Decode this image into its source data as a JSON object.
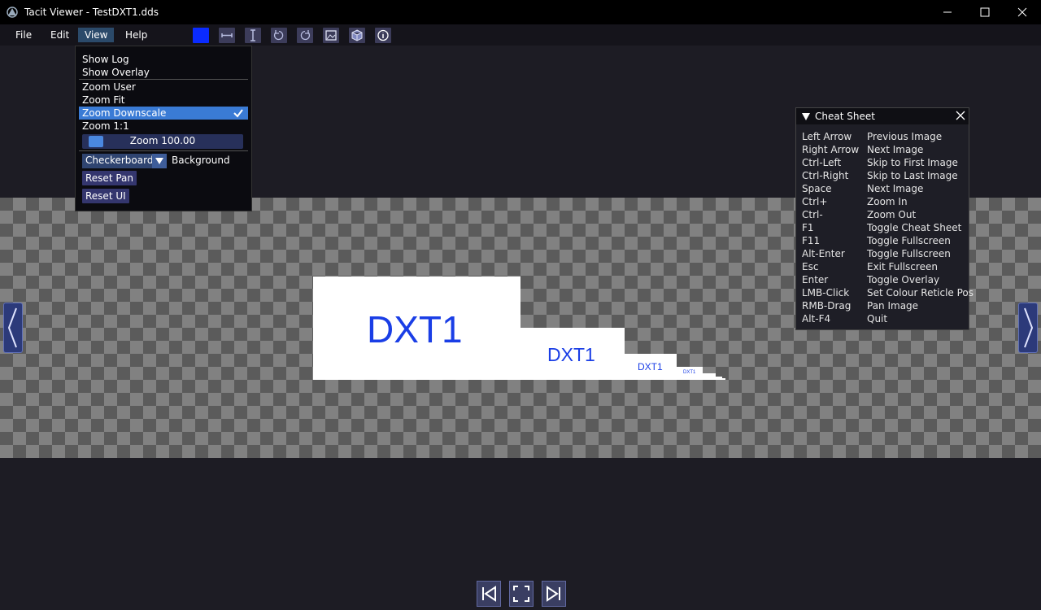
{
  "window": {
    "title": "Tacit Viewer - TestDXT1.dds"
  },
  "menubar": {
    "items": [
      "File",
      "Edit",
      "View",
      "Help"
    ]
  },
  "toolbar": {
    "icons": [
      "color-swatch-icon",
      "flip-horizontal-icon",
      "flip-vertical-icon",
      "rotate-ccw-icon",
      "rotate-cw-icon",
      "image-properties-icon",
      "cube-icon",
      "info-icon"
    ],
    "swatch_color": "#0a2bff"
  },
  "view_menu": {
    "items": [
      "Show Log",
      "Show Overlay",
      "Zoom User",
      "Zoom Fit",
      "Zoom Downscale",
      "Zoom 1:1"
    ],
    "selected": "Zoom Downscale",
    "zoom_label": "Zoom 100.00",
    "background_value": "Checkerboard",
    "background_label": "Background",
    "reset_pan": "Reset Pan",
    "reset_ui": "Reset UI"
  },
  "image": {
    "mip_label": "DXT1"
  },
  "cheat_sheet": {
    "title": "Cheat Sheet",
    "rows": [
      {
        "key": "Left Arrow",
        "action": "Previous Image"
      },
      {
        "key": "Right Arrow",
        "action": "Next Image"
      },
      {
        "key": "Ctrl-Left",
        "action": "Skip to First Image"
      },
      {
        "key": "Ctrl-Right",
        "action": "Skip to Last Image"
      },
      {
        "key": "Space",
        "action": "Next Image"
      },
      {
        "key": "Ctrl+",
        "action": "Zoom In"
      },
      {
        "key": "Ctrl-",
        "action": "Zoom Out"
      },
      {
        "key": "F1",
        "action": "Toggle Cheat Sheet"
      },
      {
        "key": "F11",
        "action": "Toggle Fullscreen"
      },
      {
        "key": "Alt-Enter",
        "action": "Toggle Fullscreen"
      },
      {
        "key": "Esc",
        "action": "Exit Fullscreen"
      },
      {
        "key": "Enter",
        "action": "Toggle Overlay"
      },
      {
        "key": "LMB-Click",
        "action": "Set Colour Reticle Pos"
      },
      {
        "key": "RMB-Drag",
        "action": "Pan Image"
      },
      {
        "key": "Alt-F4",
        "action": "Quit"
      }
    ]
  },
  "colors": {
    "accent": "#3a7bd5",
    "dxt_text": "#1a3ee6"
  }
}
